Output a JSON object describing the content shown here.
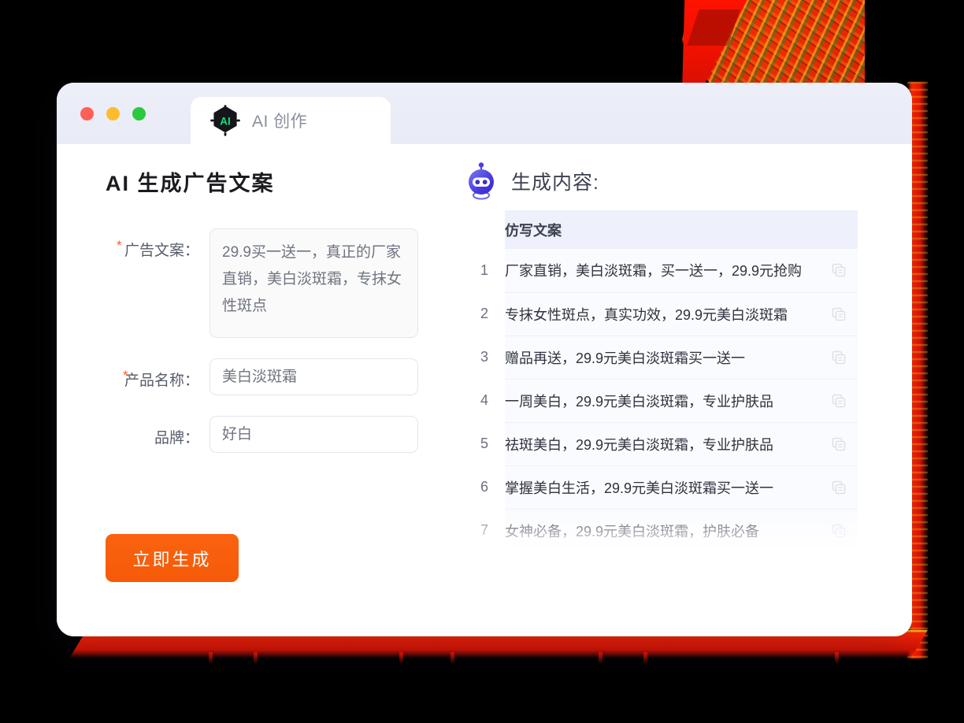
{
  "window": {
    "traffic_lights": [
      {
        "name": "close",
        "color": "#ff5f57"
      },
      {
        "name": "minimize",
        "color": "#fdbc2e"
      },
      {
        "name": "maximize",
        "color": "#2cc840"
      }
    ],
    "tab": {
      "label": "AI 创作",
      "icon": "ai-hexagon-chip-icon",
      "icon_text": "AI",
      "icon_accent": "#18e07a"
    }
  },
  "left": {
    "page_title": "AI 生成广告文案",
    "fields": [
      {
        "label": "广告文案：",
        "required": true,
        "type": "textarea",
        "value": "29.9买一送一，真正的厂家直销，美白淡斑霜，专抹女性斑点"
      },
      {
        "label": "产品名称：",
        "required": true,
        "type": "input",
        "value": "美白淡斑霜"
      },
      {
        "label": "品牌：",
        "required": false,
        "type": "input",
        "value": "好白"
      }
    ],
    "generate_button": {
      "label": "立即生成",
      "color": "#f85e0c"
    }
  },
  "right": {
    "header_title": "生成内容:",
    "header_icon": "robot-head-icon",
    "table": {
      "columns": [
        "",
        "仿写文案"
      ],
      "rows": [
        {
          "n": "1",
          "text": "厂家直销，美白淡斑霜，买一送一，29.9元抢购"
        },
        {
          "n": "2",
          "text": "专抹女性斑点，真实功效，29.9元美白淡斑霜"
        },
        {
          "n": "3",
          "text": "赠品再送，29.9元美白淡斑霜买一送一"
        },
        {
          "n": "4",
          "text": "一周美白，29.9元美白淡斑霜，专业护肤品"
        },
        {
          "n": "5",
          "text": "祛斑美白，29.9元美白淡斑霜，专业护肤品"
        },
        {
          "n": "6",
          "text": "掌握美白生活，29.9元美白淡斑霜买一送一"
        },
        {
          "n": "7",
          "text": "女神必备，29.9元美白淡斑霜，护肤必备"
        }
      ],
      "row_action_icon": "copy-icon"
    }
  },
  "decor": {
    "accent_red": "#ee1500",
    "header_bg": "#eceef8"
  }
}
